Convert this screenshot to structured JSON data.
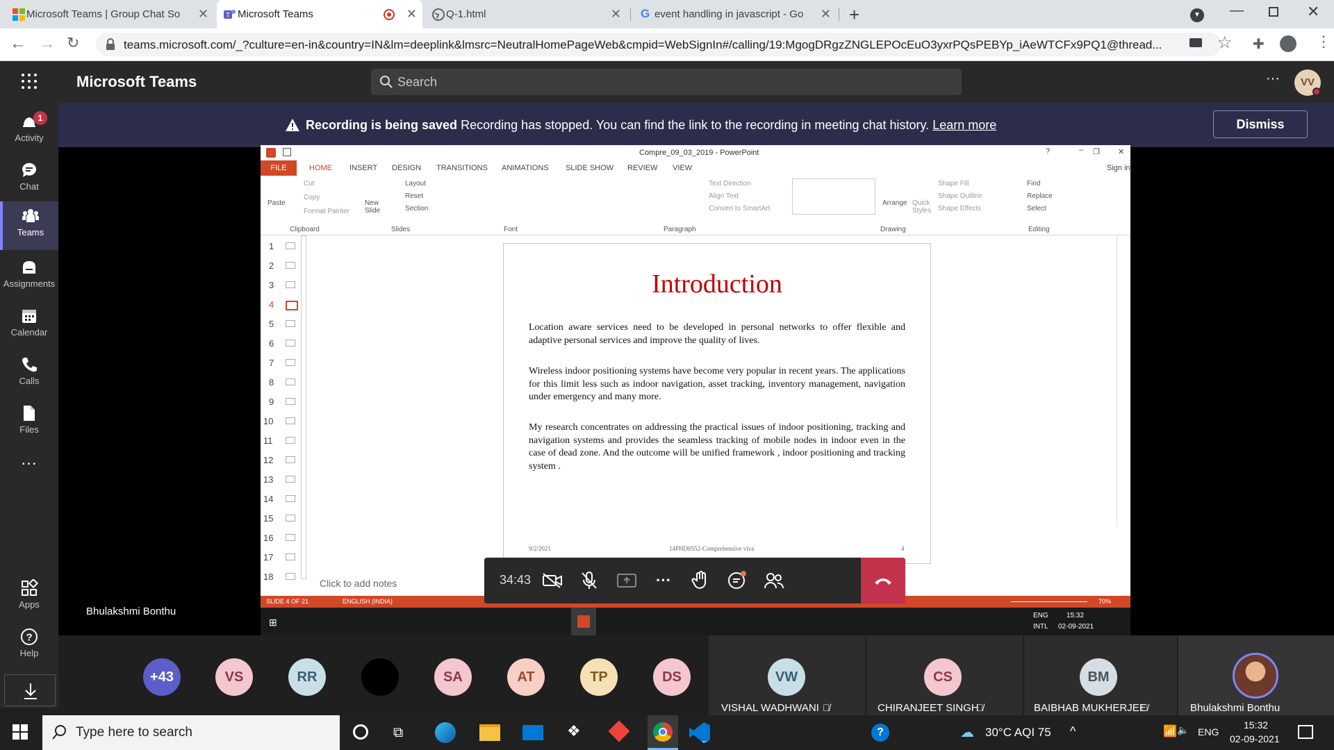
{
  "browser": {
    "tabs": [
      {
        "title": "Microsoft Teams | Group Chat So",
        "active": false
      },
      {
        "title": "Microsoft Teams",
        "active": true,
        "recording": true
      },
      {
        "title": "Q-1.html",
        "active": false
      },
      {
        "title": "event handling in javascript - Go",
        "active": false
      }
    ],
    "url": "teams.microsoft.com/_?culture=en-in&country=IN&lm=deeplink&lmsrc=NeutralHomePageWeb&cmpid=WebSignIn#/calling/19:MgogDRgzZNGLEPOcEuO3yxrPQsPEBYp_iAeWTCFx9PQ1@thread..."
  },
  "teams": {
    "title": "Microsoft Teams",
    "search_placeholder": "Search",
    "user_initials": "VV",
    "rail": [
      {
        "label": "Activity",
        "badge": "1"
      },
      {
        "label": "Chat"
      },
      {
        "label": "Teams"
      },
      {
        "label": "Assignments"
      },
      {
        "label": "Calendar"
      },
      {
        "label": "Calls"
      },
      {
        "label": "Files"
      },
      {
        "label": "..."
      },
      {
        "label": "Apps"
      },
      {
        "label": "Help"
      }
    ],
    "banner": {
      "bold": "Recording is being saved",
      "text": "Recording has stopped. You can find the link to the recording in meeting chat history.",
      "link": "Learn more",
      "dismiss": "Dismiss"
    }
  },
  "ppt": {
    "window_title": "Compre_09_03_2019 - PowerPoint",
    "sign_in": "Sign in",
    "menus": [
      "FILE",
      "HOME",
      "INSERT",
      "DESIGN",
      "TRANSITIONS",
      "ANIMATIONS",
      "SLIDE SHOW",
      "REVIEW",
      "VIEW"
    ],
    "ribbon_groups": [
      "Clipboard",
      "Slides",
      "Font",
      "Paragraph",
      "Drawing",
      "Editing"
    ],
    "ribbon_items": {
      "cut": "Cut",
      "copy": "Copy",
      "format_painter": "Format Painter",
      "paste": "Paste",
      "new_slide": "New Slide",
      "layout": "Layout",
      "reset": "Reset",
      "section": "Section",
      "text_direction": "Text Direction",
      "align_text": "Align Text",
      "smartart": "Convert to SmartArt",
      "arrange": "Arrange",
      "quick_styles": "Quick Styles",
      "shape_fill": "Shape Fill",
      "shape_outline": "Shape Outline",
      "shape_effects": "Shape Effects",
      "find": "Find",
      "replace": "Replace",
      "select": "Select"
    },
    "slide_numbers": [
      "1",
      "2",
      "3",
      "4",
      "5",
      "6",
      "7",
      "8",
      "9",
      "10",
      "11",
      "12",
      "13",
      "14",
      "15",
      "16",
      "17",
      "18"
    ],
    "slide": {
      "title": "Introduction",
      "p1": "Location aware services need to be developed in personal networks to offer flexible and adaptive personal services and improve the quality of lives.",
      "p2": "Wireless indoor positioning systems have become very popular in recent years. The applications for this limit less such as indoor navigation, asset tracking, inventory management, navigation under emergency and many more.",
      "p3": "My research concentrates on addressing the practical issues of indoor positioning, tracking and navigation systems and provides the seamless tracking of mobile nodes in indoor even in the case of dead zone. And the outcome will be unified framework , indoor positioning and tracking system .",
      "footer_date": "9/2/2021",
      "footer_mid": "14PHD0552-Comprehensive viva",
      "footer_num": "4"
    },
    "notes_placeholder": "Click to add notes",
    "status_slide": "SLIDE 4 OF 21",
    "status_lang": "ENGLISH (INDIA)",
    "zoom": "70%",
    "inner_tray": {
      "lang": "ENG",
      "layout": "INTL",
      "time": "15:32",
      "date": "02-09-2021"
    }
  },
  "call": {
    "timer": "34:43",
    "speaker": "Bhulakshmi Bonthu"
  },
  "participants": [
    {
      "initials": "+43",
      "bg": "#5b5fc7",
      "fg": "#ffffff"
    },
    {
      "initials": "VS",
      "bg": "#f4c6cf",
      "fg": "#8a3a4a"
    },
    {
      "initials": "RR",
      "bg": "#c9dfe8",
      "fg": "#3a5f6e"
    },
    {
      "initials": "",
      "bg": "#000000",
      "fg": "#000000"
    },
    {
      "initials": "SA",
      "bg": "#f4c6cf",
      "fg": "#8a3a4a"
    },
    {
      "initials": "AT",
      "bg": "#f7cfc4",
      "fg": "#9a4a36"
    },
    {
      "initials": "TP",
      "bg": "#f6e1b6",
      "fg": "#7a5a1e"
    },
    {
      "initials": "DS",
      "bg": "#f4c6cf",
      "fg": "#8a3a4a"
    }
  ],
  "tiles": [
    {
      "initials": "VW",
      "name": "VISHAL WADHWANI",
      "bg": "#c9dfe8",
      "fg": "#3a5f6e"
    },
    {
      "initials": "CS",
      "name": "CHIRANJEET SINGH",
      "bg": "#f4c6cf",
      "fg": "#8a3a4a"
    },
    {
      "initials": "BM",
      "name": "BAIBHAB MUKHERJEE",
      "bg": "#d6dde3",
      "fg": "#4a5560"
    },
    {
      "initials": "",
      "name": "Bhulakshmi Bonthu",
      "bg": "#e9a66b",
      "fg": "#ffffff"
    }
  ],
  "windows": {
    "search_placeholder": "Type here to search",
    "weather": "30°C AQI 75",
    "lang": "ENG",
    "time": "15:32",
    "date": "02-09-2021"
  }
}
